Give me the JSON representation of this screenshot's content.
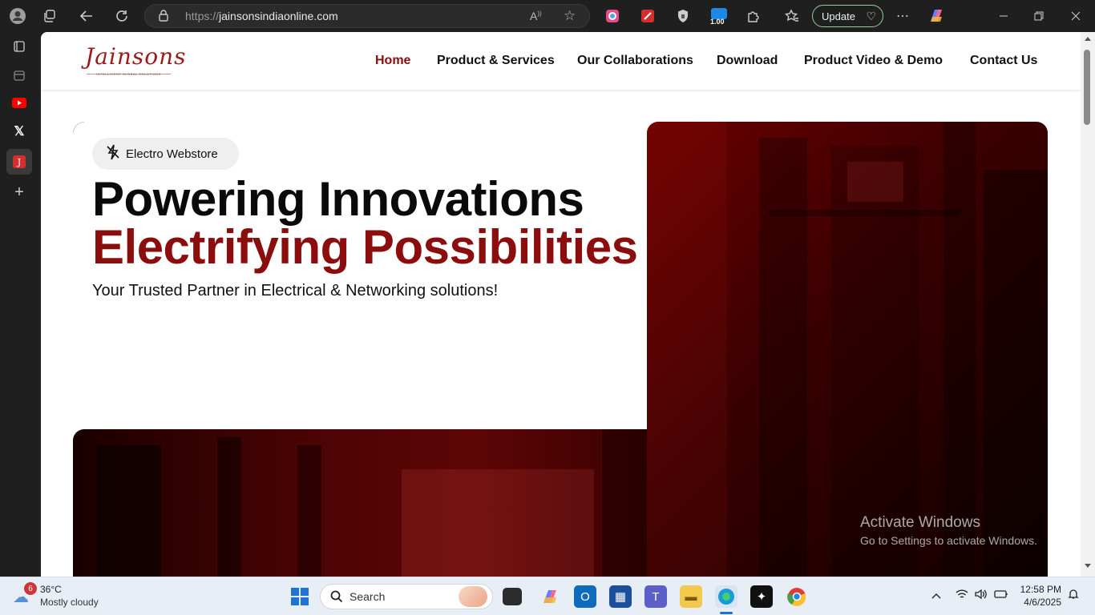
{
  "browser": {
    "url_protocol": "https://",
    "url_host": "jainsonsindiaonline.com",
    "update_label": "Update",
    "extension_badge": "1.00"
  },
  "site": {
    "logo_text": "Jainsons",
    "logo_tagline": "INTELLIGENT GLOBAL SOLUTIONS",
    "nav": [
      {
        "label": "Home"
      },
      {
        "label": "Product & Services"
      },
      {
        "label": "Our Collaborations"
      },
      {
        "label": "Download"
      },
      {
        "label": "Product Video & Demo"
      },
      {
        "label": "Contact Us"
      }
    ],
    "hero": {
      "pill": "Electro Webstore",
      "headline_1": "Powering Innovations",
      "headline_2": "Electrifying Possibilities",
      "subtext": "Your Trusted Partner in Electrical & Networking solutions!"
    },
    "colors": {
      "brand": "#8b0d0d"
    }
  },
  "watermark": {
    "line1": "Activate Windows",
    "line2": "Go to Settings to activate Windows."
  },
  "taskbar": {
    "weather_temp": "36°C",
    "weather_desc": "Mostly cloudy",
    "weather_badge": "6",
    "search_placeholder": "Search",
    "time": "12:58 PM",
    "date": "4/6/2025"
  }
}
